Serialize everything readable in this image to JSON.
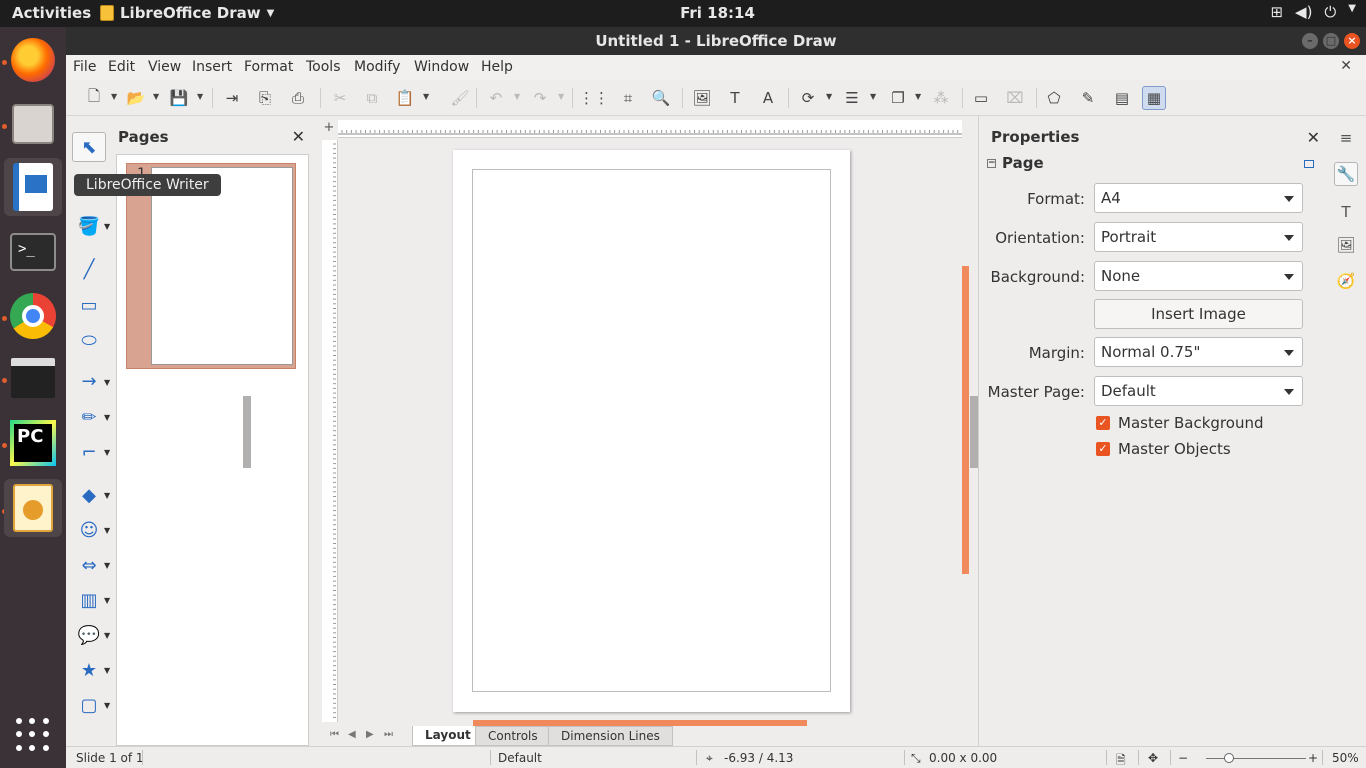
{
  "topbar": {
    "activities": "Activities",
    "app_name": "LibreOffice Draw",
    "clock": "Fri 18:14"
  },
  "tooltip": "LibreOffice Writer",
  "window": {
    "title": "Untitled 1 - LibreOffice Draw"
  },
  "menu": {
    "file": "File",
    "edit": "Edit",
    "view": "View",
    "insert": "Insert",
    "format": "Format",
    "tools": "Tools",
    "modify": "Modify",
    "window": "Window",
    "help": "Help"
  },
  "pages_pane": {
    "title": "Pages",
    "page_number": "1"
  },
  "sheet_tabs": {
    "layout": "Layout",
    "controls": "Controls",
    "dimension_lines": "Dimension Lines"
  },
  "properties": {
    "title": "Properties",
    "section": "Page",
    "format_label": "Format:",
    "format_value": "A4",
    "orientation_label": "Orientation:",
    "orientation_value": "Portrait",
    "background_label": "Background:",
    "background_value": "None",
    "insert_image": "Insert Image",
    "margin_label": "Margin:",
    "margin_value": "Normal 0.75\"",
    "master_page_label": "Master Page:",
    "master_page_value": "Default",
    "master_background": "Master Background",
    "master_objects": "Master Objects"
  },
  "statusbar": {
    "slide": "Slide 1 of 1",
    "master": "Default",
    "position": "-6.93 / 4.13",
    "size": "0.00 x 0.00",
    "zoom": "50%"
  },
  "colors": {
    "accent": "#e95420",
    "scrollbar": "#f08a5d"
  }
}
